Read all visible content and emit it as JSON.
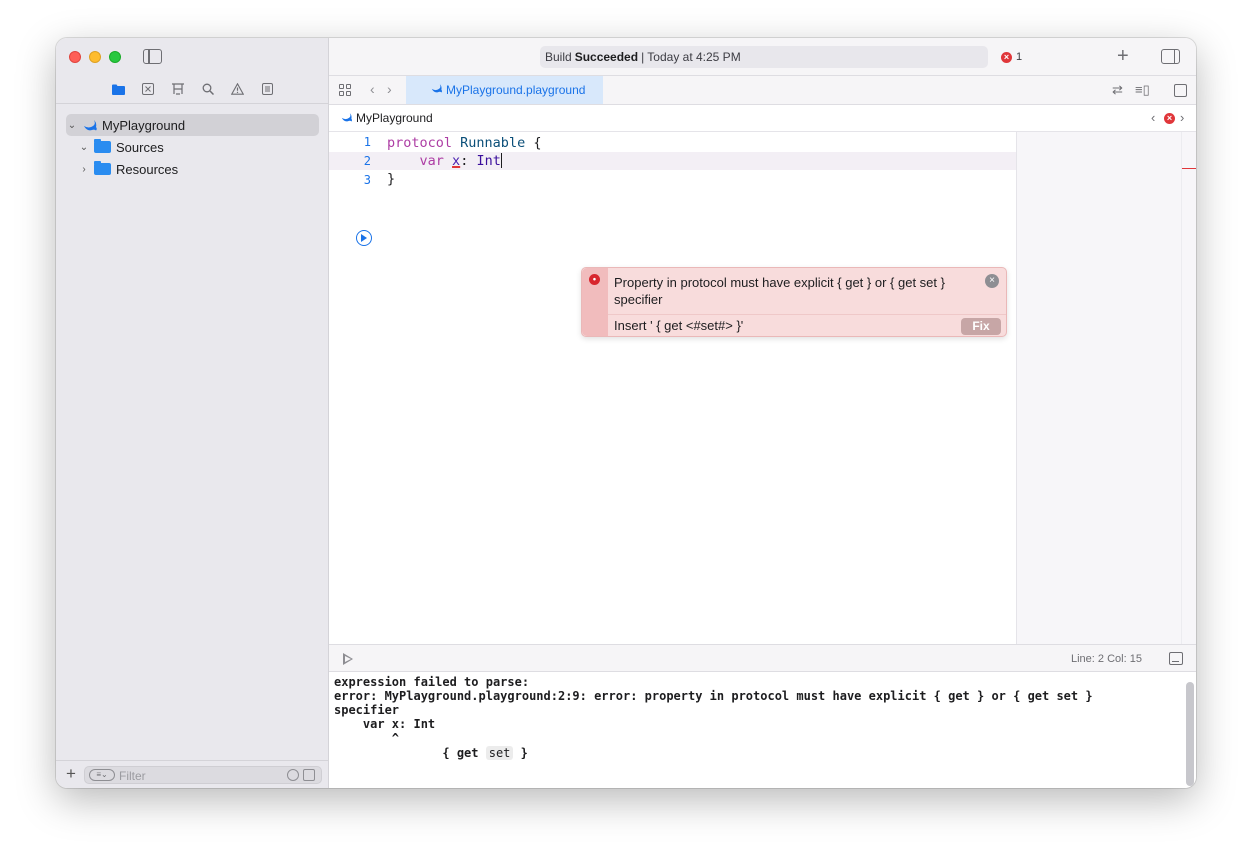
{
  "window": {
    "build_status_prefix": "Build",
    "build_status_bold": "Succeeded",
    "build_status_suffix": "| Today at 4:25 PM",
    "error_count": "1"
  },
  "sidebar": {
    "nav_icons": [
      "folder-icon",
      "source-control-icon",
      "symbol-icon",
      "search-icon",
      "warning-icon",
      "report-icon"
    ],
    "tree": [
      {
        "label": "MyPlayground",
        "icon": "swift-icon",
        "expanded": true,
        "selected": true
      },
      {
        "label": "Sources",
        "icon": "folder-icon",
        "expanded": true
      },
      {
        "label": "Resources",
        "icon": "folder-icon",
        "expanded": false
      }
    ],
    "filter_placeholder": "Filter"
  },
  "tabbar": {
    "active_tab": "MyPlayground.playground"
  },
  "jumpbar": {
    "path": "MyPlayground"
  },
  "editor": {
    "line_numbers": [
      "1",
      "2",
      "3"
    ],
    "line1": {
      "kw": "protocol",
      "type": "Runnable",
      "rest": " {"
    },
    "line2": {
      "indent": "    ",
      "kw": "var",
      "name": "x",
      "colon": ": ",
      "type": "Int"
    },
    "line3": "}"
  },
  "error_popover": {
    "message": "Property in protocol must have explicit { get } or { get set } specifier",
    "fix_text": "Insert ' { get <#set#> }'",
    "fix_label": "Fix"
  },
  "debugbar": {
    "line_col": "Line: 2  Col: 15"
  },
  "console": {
    "lines": [
      "expression failed to parse:",
      "error: MyPlayground.playground:2:9: error: property in protocol must have explicit { get } or { get set }",
      "specifier",
      "    var x: Int",
      "        ^"
    ],
    "fix_prefix": "               { get ",
    "fix_token": "set",
    "fix_suffix": " }"
  },
  "colors": {
    "accent": "#1a73e8",
    "error": "#e0363a",
    "keyword": "#ad3da4",
    "type": "#0b4f79",
    "popover_bg": "#f8dcdc"
  }
}
